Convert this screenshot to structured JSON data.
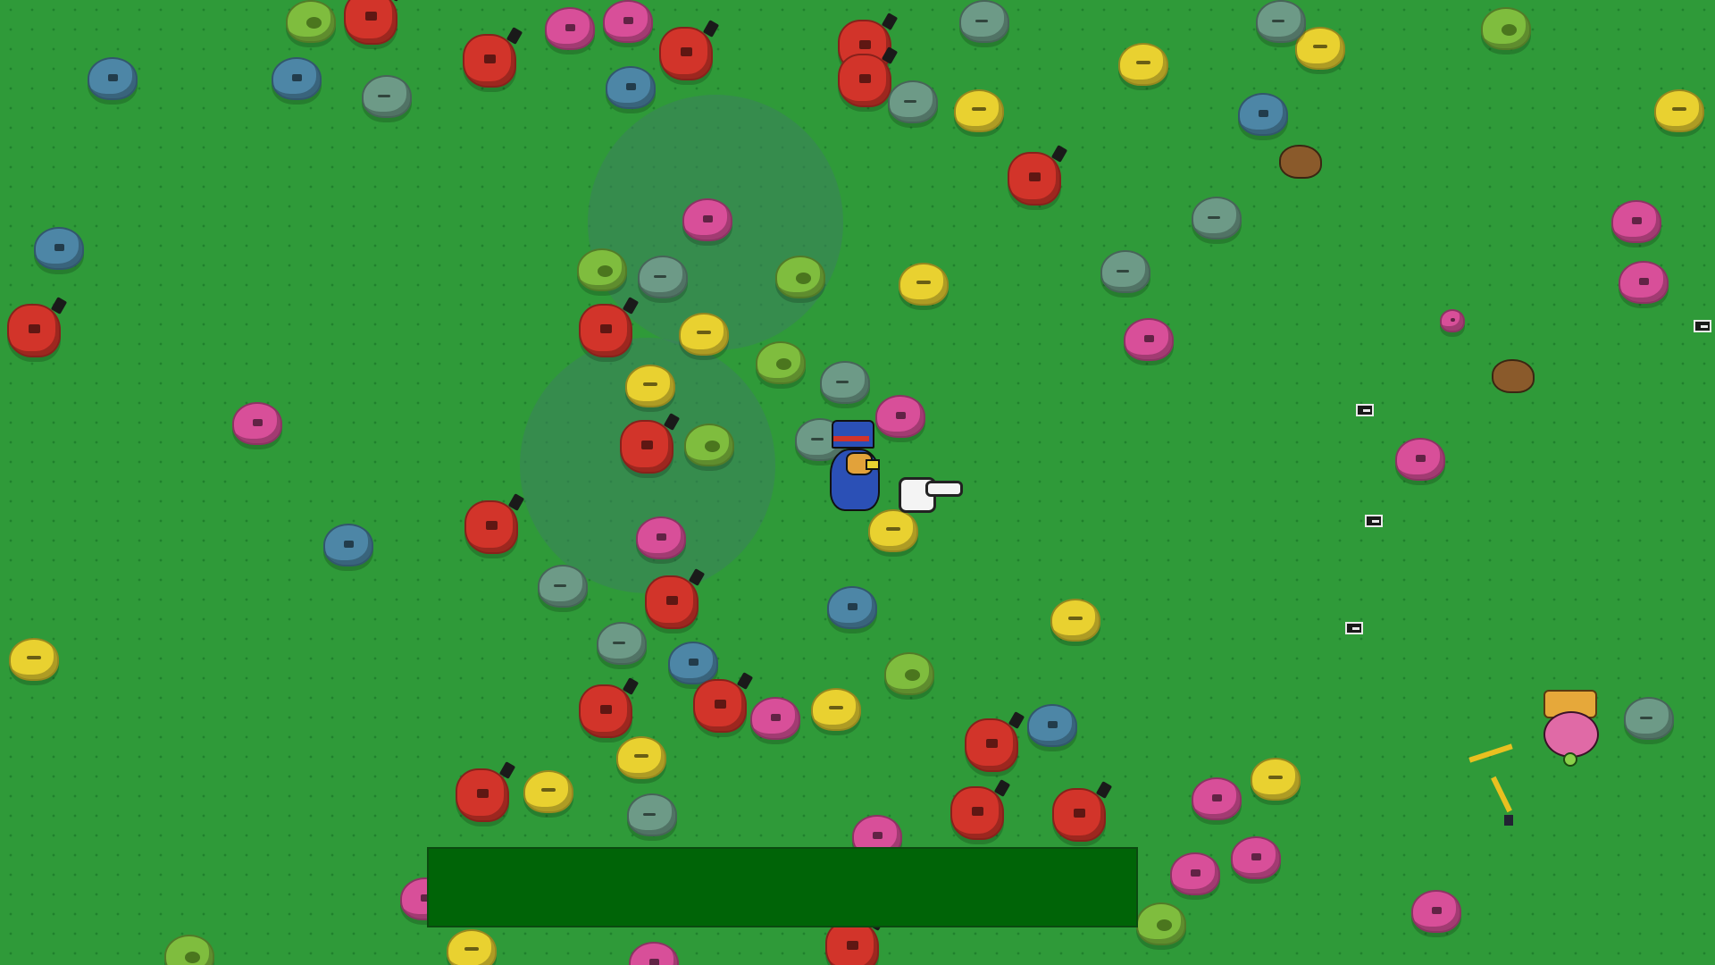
{
  "scene": {
    "name": "grass-field",
    "background_color": "#2f9a39",
    "enemy_colors": {
      "red": "#d2342a",
      "pink": "#d84f99",
      "yellow": "#e9d130",
      "slate": "#6d9a87",
      "blue": "#4d86a6",
      "lime": "#7fbd3e"
    }
  },
  "player": {
    "character": "blue-hat-bird"
  },
  "cursor": {
    "icon": "pointing-hand-icon"
  },
  "boss": {
    "icon": "crowned-pink-slime"
  },
  "dialog": {
    "text": ""
  }
}
